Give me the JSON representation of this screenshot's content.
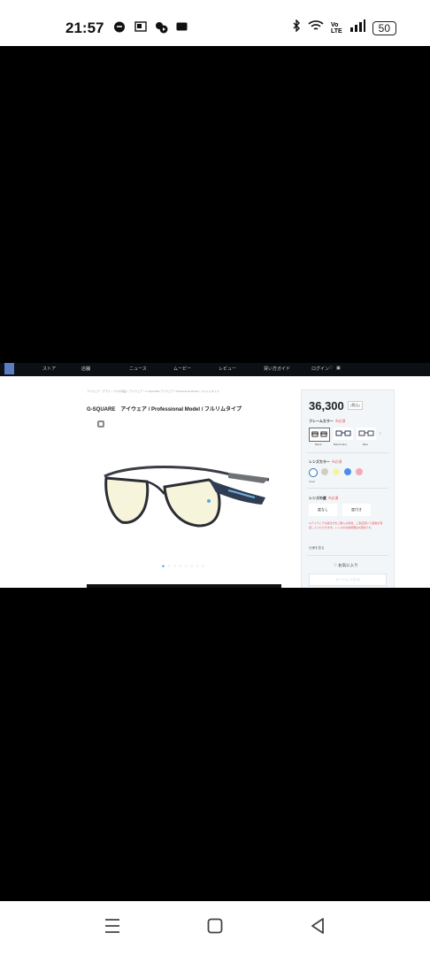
{
  "status_bar": {
    "time": "21:57",
    "battery": "50",
    "network_label": "VoLTE"
  },
  "web": {
    "nav": [
      "ストア",
      "店舗",
      "ニュース",
      "ムービー",
      "レビュー",
      "買い方ガイド",
      "ログイン"
    ],
    "breadcrumb": "アイウェア・グラス・スマホ用品 > アイウェア > G-SQUARE アイウェア / Professional Model / フルリムタイプ",
    "product_title": "G-SQUARE　アイウェア / Professional Model / フルリムタイプ",
    "panel": {
      "price": "36,300",
      "tax_label": "(税込)",
      "frame_color_label": "フレームカラー",
      "required_label": "※必須",
      "frame_options": [
        "Black",
        "Black-Navy",
        "Blue"
      ],
      "lens_color_label": "レンズカラー",
      "lens_selected": "Clear",
      "lens_swatch_colors": [
        "#ffffff",
        "#cfcfc0",
        "#f7f3a6",
        "#4b8de6",
        "#f3a9bd"
      ],
      "lens_degree_label": "レンズの度",
      "lens_degree_options": [
        "度なし",
        "度付き"
      ],
      "notice": "※アイウェアの度付きをご購入の場合、ご来店頂いて度数を測定していただきます。レンズの交換所要は3週間です。",
      "detail_link": "仕様を見る",
      "favorite_label": "お気に入り",
      "cart_label": "カートに入れる"
    }
  },
  "nav_bar": {
    "buttons": [
      "menu",
      "home",
      "back"
    ]
  }
}
